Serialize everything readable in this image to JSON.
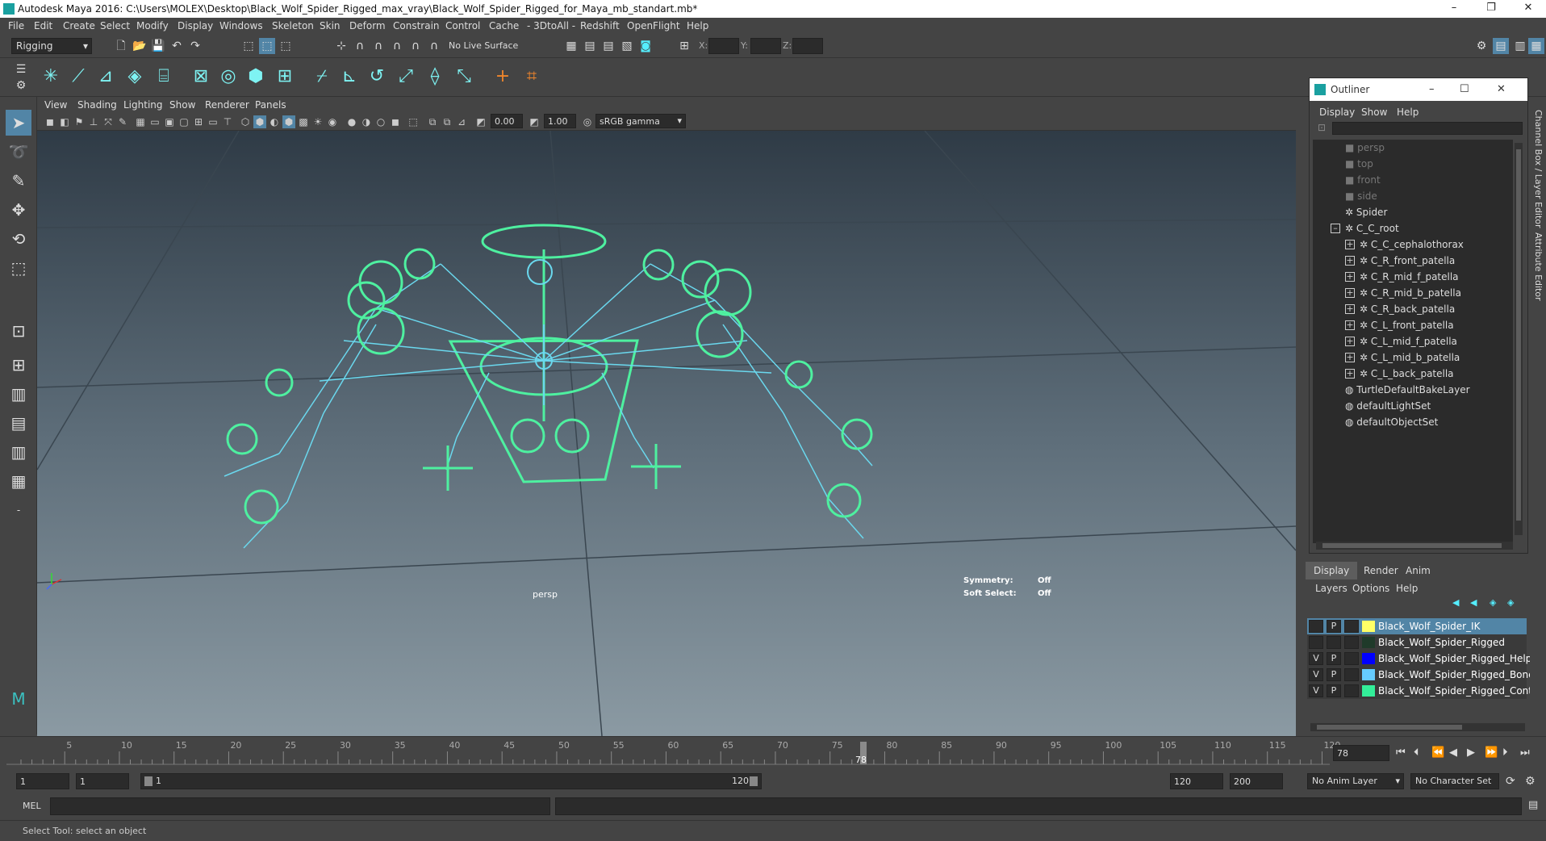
{
  "window": {
    "title": "Autodesk Maya 2016: C:\\Users\\MOLEX\\Desktop\\Black_Wolf_Spider_Rigged_max_vray\\Black_Wolf_Spider_Rigged_for_Maya_mb_standart.mb*",
    "minimize": "–",
    "maximize": "❐",
    "close": "✕"
  },
  "menubar": [
    "File",
    "Edit",
    "Create",
    "Select",
    "Modify",
    "Display",
    "Windows",
    "Skeleton",
    "Skin",
    "Deform",
    "Constrain",
    "Control",
    "Cache",
    "- 3DtoAll -",
    "Redshift",
    "OpenFlight",
    "Help"
  ],
  "statusline": {
    "mode": "Rigging",
    "live_surface": "No Live Surface",
    "x_label": "X:",
    "y_label": "Y:",
    "z_label": "Z:"
  },
  "viewport": {
    "menus": [
      "View",
      "Shading",
      "Lighting",
      "Show",
      "Renderer",
      "Panels"
    ],
    "near_value": "0.00",
    "far_value": "1.00",
    "color_space": "sRGB gamma",
    "camera_label": "persp",
    "symmetry_label": "Symmetry:",
    "symmetry_value": "Off",
    "soft_select_label": "Soft Select:",
    "soft_select_value": "Off"
  },
  "outliner": {
    "title": "Outliner",
    "menus": [
      "Display",
      "Show",
      "Help"
    ],
    "items": [
      {
        "label": "persp",
        "dim": true
      },
      {
        "label": "top",
        "dim": true
      },
      {
        "label": "front",
        "dim": true
      },
      {
        "label": "side",
        "dim": true
      },
      {
        "label": "Spider",
        "dim": false
      },
      {
        "label": "C_C_root",
        "dim": false
      },
      {
        "label": "C_C_cephalothorax",
        "dim": false
      },
      {
        "label": "C_R_front_patella",
        "dim": false
      },
      {
        "label": "C_R_mid_f_patella",
        "dim": false
      },
      {
        "label": "C_R_mid_b_patella",
        "dim": false
      },
      {
        "label": "C_R_back_patella",
        "dim": false
      },
      {
        "label": "C_L_front_patella",
        "dim": false
      },
      {
        "label": "C_L_mid_f_patella",
        "dim": false
      },
      {
        "label": "C_L_mid_b_patella",
        "dim": false
      },
      {
        "label": "C_L_back_patella",
        "dim": false
      },
      {
        "label": "TurtleDefaultBakeLayer",
        "dim": false
      },
      {
        "label": "defaultLightSet",
        "dim": false
      },
      {
        "label": "defaultObjectSet",
        "dim": false
      }
    ]
  },
  "layer_editor": {
    "tabs": [
      "Display",
      "Render",
      "Anim"
    ],
    "menus": [
      "Layers",
      "Options",
      "Help"
    ],
    "layers": [
      {
        "v": "",
        "p": "P",
        "name": "Black_Wolf_Spider_IK",
        "color": "#ffff66",
        "selected": true
      },
      {
        "v": "",
        "p": "",
        "name": "Black_Wolf_Spider_Rigged",
        "color": "#1f3a2a",
        "selected": false
      },
      {
        "v": "V",
        "p": "P",
        "name": "Black_Wolf_Spider_Rigged_Helpers",
        "color": "#0000ff",
        "selected": false
      },
      {
        "v": "V",
        "p": "P",
        "name": "Black_Wolf_Spider_Rigged_Bones",
        "color": "#66ccff",
        "selected": false
      },
      {
        "v": "V",
        "p": "P",
        "name": "Black_Wolf_Spider_Rigged_Controllers",
        "color": "#33ee99",
        "selected": false
      }
    ]
  },
  "timeline": {
    "ticks": [
      "5",
      "10",
      "15",
      "20",
      "25",
      "30",
      "35",
      "40",
      "45",
      "50",
      "55",
      "60",
      "65",
      "70",
      "75",
      "80",
      "85",
      "90",
      "95",
      "100",
      "105",
      "110",
      "115",
      "120"
    ],
    "current_frame": "78",
    "current_frame_field": "78"
  },
  "range": {
    "start": "1",
    "playback_start": "1",
    "slider_start": "1",
    "slider_end": "120",
    "playback_end": "120",
    "end": "200",
    "anim_layer": "No Anim Layer",
    "character_set": "No Character Set"
  },
  "cmdline": {
    "label": "MEL"
  },
  "helpline": {
    "text": "Select Tool: select an object"
  },
  "sidebar": {
    "channel_box": "Channel Box / Layer Editor",
    "attribute_editor": "Attribute Editor"
  },
  "colors": {
    "rig_green": "#4ef0a0",
    "bone_cyan": "#6ad8ee",
    "selection_blue": "#5285a6"
  }
}
